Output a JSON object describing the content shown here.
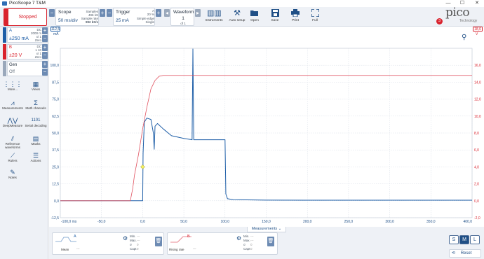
{
  "window": {
    "title": "PicoScope 7 T&M",
    "controls": [
      "—",
      "☐",
      "✕"
    ]
  },
  "toolbar": {
    "run_button": "Stopped",
    "scope": {
      "label": "Scope",
      "value": "50 ms/div",
      "samples_label": "Samples",
      "samples": "496 kS",
      "rate_label": "Sample rate",
      "rate": "992 kS/s"
    },
    "trigger": {
      "label": "Trigger",
      "value": "25 mA",
      "ch": "A",
      "pct": "20 %",
      "type": "Simple edge",
      "mode": "Single"
    },
    "waveform": {
      "label": "Waveform",
      "value": "1",
      "of": "of 1"
    },
    "buttons": {
      "instruments": "Instruments",
      "auto_setup": "Auto setup",
      "open": "Open",
      "save": "Save",
      "print": "Print",
      "full": "Full"
    },
    "notification_count": "3",
    "brand": "pico",
    "brand_sub": "Technology"
  },
  "channels": [
    {
      "letter": "A",
      "range": "±250 mA",
      "coupling": "DC",
      "rate": "2000 m",
      "probe": "x/ 1",
      "extra": "Zero",
      "color": "#1f5fa8"
    },
    {
      "letter": "B",
      "range": "±20 V",
      "coupling": "DC",
      "rate": "x 10",
      "probe": "x/ 1",
      "extra": "Zero",
      "color": "#d9232e"
    }
  ],
  "generator": {
    "label": "Gen",
    "value": "Off"
  },
  "sidebar": {
    "items": [
      {
        "label": "More...",
        "icon": "grid-icon"
      },
      {
        "label": "Views",
        "icon": "views-icon"
      },
      {
        "label": "Measurements",
        "icon": "measurements-icon"
      },
      {
        "label": "Math channels",
        "icon": "sigma-icon"
      },
      {
        "label": "DeepMeasure",
        "icon": "deepmeasure-icon"
      },
      {
        "label": "Serial decoding",
        "icon": "serial-icon"
      },
      {
        "label": "Reference waveforms",
        "icon": "reference-icon"
      },
      {
        "label": "Masks",
        "icon": "masks-icon"
      },
      {
        "label": "Rulers",
        "icon": "ruler-icon"
      },
      {
        "label": "Actions",
        "icon": "actions-icon"
      },
      {
        "label": "Notes",
        "icon": "notes-icon"
      }
    ]
  },
  "plot": {
    "left_unit": "mA",
    "left_top": "112,5",
    "right_unit": "V",
    "right_top": "18,0",
    "x_unit": "ms",
    "x_first": "-100,0 ms"
  },
  "chart_data": {
    "type": "line",
    "x_ticks": [
      "-100,0 ms",
      "-50,0",
      "0,0",
      "50,0",
      "100,0",
      "150,0",
      "200,0",
      "250,0",
      "300,0",
      "350,0",
      "400,0"
    ],
    "x_range": [
      -100,
      400
    ],
    "y_left": {
      "unit": "mA",
      "ticks": [
        "100,0",
        "87,5",
        "75,0",
        "62,5",
        "50,0",
        "37,5",
        "25,0",
        "12,5",
        "0,0",
        "-12,5"
      ],
      "range": [
        -12.5,
        112.5
      ]
    },
    "y_right": {
      "unit": "V",
      "ticks": [
        "16,0",
        "14,0",
        "12,0",
        "10,0",
        "8,0",
        "6,0",
        "4,0",
        "2,0",
        "0,0",
        "-2,0"
      ],
      "range": [
        -2,
        18
      ]
    },
    "grid": true,
    "series": [
      {
        "color": "#1f5fa8",
        "axis": "left",
        "x": [
          -100,
          0,
          0.5,
          2,
          5,
          10,
          13,
          14,
          15,
          18,
          25,
          35,
          50,
          60,
          61,
          62,
          63,
          70,
          80,
          90,
          100,
          101,
          103,
          110,
          150,
          200,
          300,
          400
        ],
        "y": [
          0,
          0,
          35,
          58,
          61,
          60,
          50,
          38,
          55,
          57,
          53,
          48,
          46,
          45,
          112,
          45,
          45,
          45,
          45,
          45,
          45,
          5,
          1.5,
          0.8,
          0.5,
          0.4,
          0.4,
          0.4
        ]
      },
      {
        "color": "#e0515f",
        "axis": "right",
        "x": [
          -100,
          -15,
          -12,
          -10,
          -5,
          0,
          5,
          10,
          15,
          20,
          25,
          30,
          40,
          400
        ],
        "y": [
          0,
          0,
          1.5,
          3,
          5.5,
          8.5,
          11,
          13.2,
          14.2,
          14.7,
          14.8,
          14.8,
          14.8,
          14.8
        ]
      }
    ],
    "trigger_marker": {
      "x": 0,
      "y": 25
    }
  },
  "measurements": {
    "tab_label": "Measurements",
    "cards": [
      {
        "channel": "A",
        "name": "Mean",
        "value": "---",
        "stats": {
          "min": "Min.",
          "max": "Max.",
          "sd": "σ",
          "cap": "Capt",
          "min_v": "---",
          "max_v": "---",
          "sd_v": "0",
          "cap_v": "0"
        }
      },
      {
        "channel": "B",
        "name": "Rising rate",
        "value": "---",
        "stats": {
          "min": "Min.",
          "max": "Max.",
          "sd": "σ",
          "cap": "Capt",
          "min_v": "---",
          "max_v": "---",
          "sd_v": "0",
          "cap_v": "0"
        }
      }
    ],
    "sizes": [
      "S",
      "M",
      "L"
    ],
    "reset": "Reset"
  }
}
